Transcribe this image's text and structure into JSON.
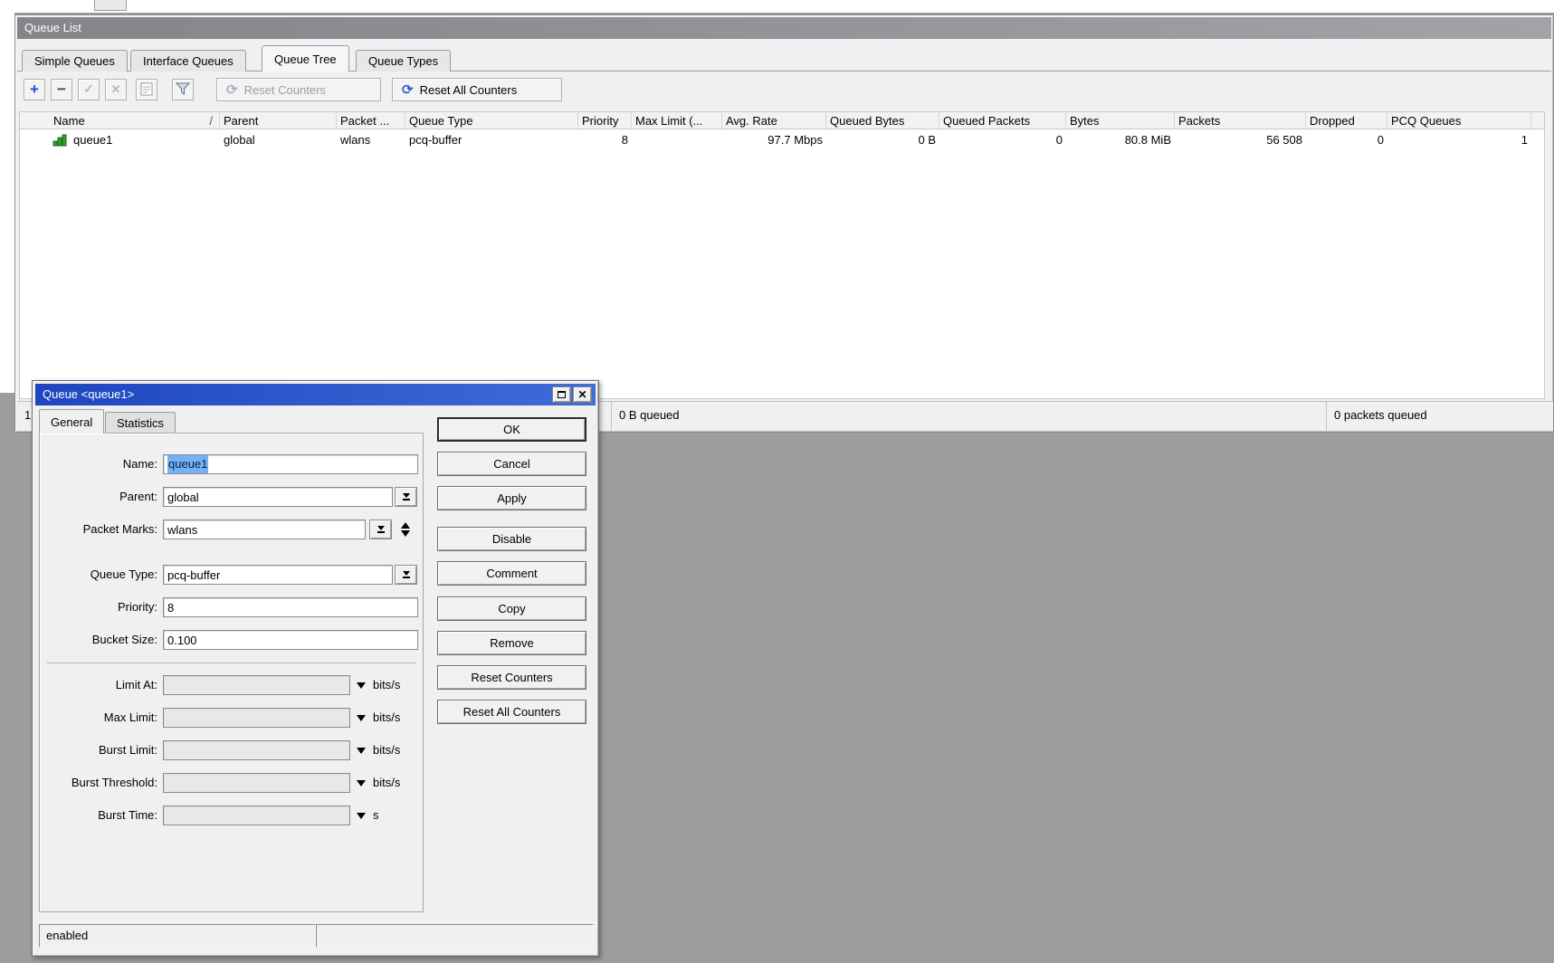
{
  "desktop": {
    "background_color": "#9d9d9d"
  },
  "icons": {
    "plus": "+",
    "minus": "−",
    "check": "✓",
    "cross": "✕",
    "reset": "⟳",
    "close": "✕"
  },
  "colors": {
    "accent_blue": "#2f5fd0",
    "dialog_titlebar": "#2a52c8",
    "selection_blue": "#74b2f4",
    "queue_icon_green": "#33a02c",
    "desktop_gray": "#9d9d9d"
  },
  "queue_list_window": {
    "title": "Queue List",
    "tabs": [
      {
        "label": "Simple Queues",
        "active": false
      },
      {
        "label": "Interface Queues",
        "active": false
      },
      {
        "label": "Queue Tree",
        "active": true
      },
      {
        "label": "Queue Types",
        "active": false
      }
    ],
    "toolbar": {
      "reset_counters_label": "Reset Counters",
      "reset_all_counters_label": "Reset All Counters"
    },
    "table": {
      "sort_indicator": "/",
      "columns": [
        "Name",
        "Parent",
        "Packet ...",
        "Queue Type",
        "Priority",
        "Max Limit (...",
        "Avg. Rate",
        "Queued Bytes",
        "Queued Packets",
        "Bytes",
        "Packets",
        "Dropped",
        "PCQ Queues"
      ],
      "rows": [
        {
          "name": "queue1",
          "parent": "global",
          "packet_marks": "wlans",
          "queue_type": "pcq-buffer",
          "priority": "8",
          "max_limit": "",
          "avg_rate": "97.7 Mbps",
          "queued_bytes": "0 B",
          "queued_packets": "0",
          "bytes": "80.8 MiB",
          "packets": "56 508",
          "dropped": "0",
          "pcq_queues": "1"
        }
      ]
    },
    "statusbar": {
      "count": "1",
      "queued_bytes": "0 B queued",
      "queued_packets": "0 packets queued"
    }
  },
  "dialog": {
    "title": "Queue <queue1>",
    "tabs": [
      {
        "label": "General",
        "active": true
      },
      {
        "label": "Statistics",
        "active": false
      }
    ],
    "fields": {
      "name": {
        "label": "Name:",
        "value": "queue1"
      },
      "parent": {
        "label": "Parent:",
        "value": "global"
      },
      "packet_marks": {
        "label": "Packet Marks:",
        "value": "wlans"
      },
      "queue_type": {
        "label": "Queue Type:",
        "value": "pcq-buffer"
      },
      "priority": {
        "label": "Priority:",
        "value": "8"
      },
      "bucket_size": {
        "label": "Bucket Size:",
        "value": "0.100"
      },
      "limit_at": {
        "label": "Limit At:",
        "value": "",
        "unit": "bits/s"
      },
      "max_limit": {
        "label": "Max Limit:",
        "value": "",
        "unit": "bits/s"
      },
      "burst_limit": {
        "label": "Burst Limit:",
        "value": "",
        "unit": "bits/s"
      },
      "burst_threshold": {
        "label": "Burst Threshold:",
        "value": "",
        "unit": "bits/s"
      },
      "burst_time": {
        "label": "Burst Time:",
        "value": "",
        "unit": "s"
      }
    },
    "buttons": [
      "OK",
      "Cancel",
      "Apply",
      "Disable",
      "Comment",
      "Copy",
      "Remove",
      "Reset Counters",
      "Reset All Counters"
    ],
    "status": "enabled"
  }
}
